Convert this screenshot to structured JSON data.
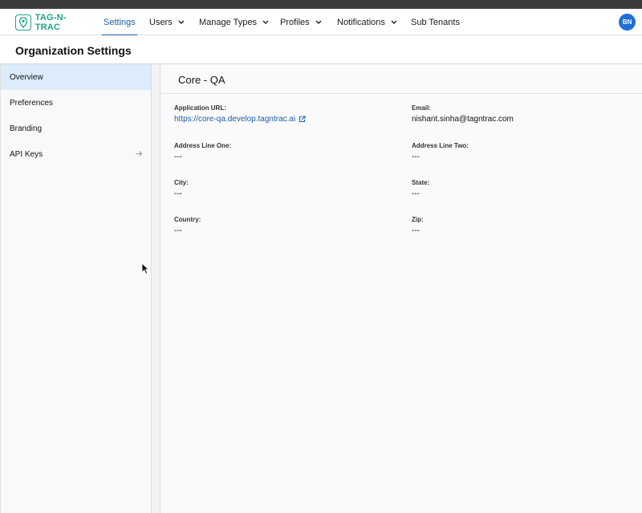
{
  "colors": {
    "accent": "#1a5fa8",
    "brand": "#1fa38a",
    "avatar_bg": "#1f6fd6",
    "active_sidebar_bg": "#dcecfb"
  },
  "navbar": {
    "logo_text": "TAG-N-TRAC",
    "items": [
      {
        "label": "Settings",
        "active": true
      },
      {
        "label": "Users",
        "dropdown": true
      },
      {
        "label": "Manage Types",
        "dropdown": true
      },
      {
        "label": "Profiles",
        "dropdown": true
      },
      {
        "label": "Notifications",
        "dropdown": true
      },
      {
        "label": "Sub Tenants"
      }
    ],
    "avatar_initials": "BN"
  },
  "page": {
    "title": "Organization Settings"
  },
  "sidebar": {
    "items": [
      {
        "label": "Overview",
        "active": true
      },
      {
        "label": "Preferences"
      },
      {
        "label": "Branding"
      },
      {
        "label": "API Keys",
        "icon": "arrow-right-icon"
      }
    ]
  },
  "main": {
    "org_name": "Core - QA",
    "fields": {
      "application_url": {
        "label": "Application URL:",
        "value": "https://core-qa.develop.tagntrac.ai"
      },
      "email": {
        "label": "Email:",
        "value": "nishant.sinha@tagntrac.com"
      },
      "address_line_one": {
        "label": "Address Line One:",
        "value": "---"
      },
      "address_line_two": {
        "label": "Address Line Two:",
        "value": "---"
      },
      "city": {
        "label": "City:",
        "value": "---"
      },
      "state": {
        "label": "State:",
        "value": "---"
      },
      "country": {
        "label": "Country:",
        "value": "---"
      },
      "zip": {
        "label": "Zip:",
        "value": "---"
      }
    }
  }
}
